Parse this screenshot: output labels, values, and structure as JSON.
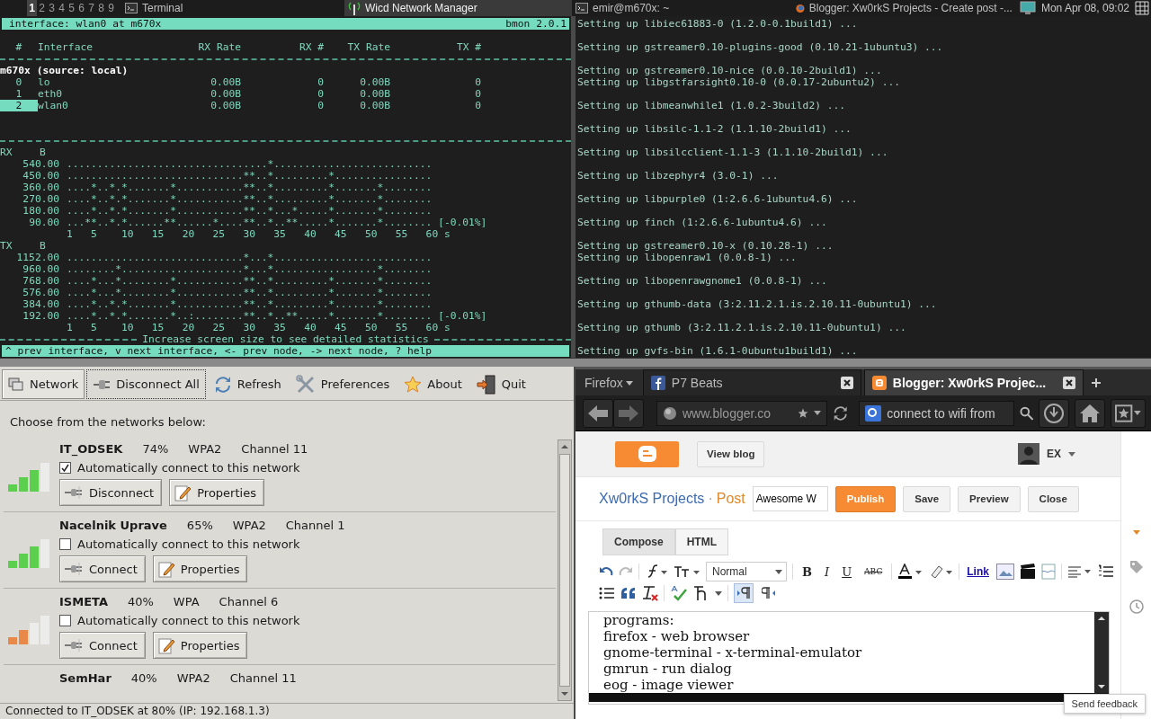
{
  "taskbar": {
    "workspaces": [
      {
        "label": "1",
        "selected": true
      },
      {
        "label": "2",
        "selected": false
      },
      {
        "label": "3",
        "selected": false
      },
      {
        "label": "4",
        "selected": false
      },
      {
        "label": "5",
        "selected": false
      },
      {
        "label": "6",
        "selected": false
      },
      {
        "label": "7",
        "selected": false
      },
      {
        "label": "8",
        "selected": false
      },
      {
        "label": "9",
        "selected": false
      }
    ],
    "tasks": [
      {
        "title": "Terminal",
        "kind": "terminal",
        "selected": false
      },
      {
        "title": "Wicd Network Manager",
        "kind": "antenna",
        "selected": true
      },
      {
        "title": "emir@m670x: ~",
        "kind": "terminal",
        "selected": false
      },
      {
        "title": "Blogger: Xw0rkS Projects - Create post -...",
        "kind": "firefox",
        "selected": false
      }
    ],
    "clock": "Mon Apr 08, 09:02"
  },
  "bmon": {
    "title": "interface: wlan0 at m670x",
    "version": "bmon 2.0.1",
    "columns": [
      "#",
      "Interface",
      "RX Rate",
      "RX #",
      "TX Rate",
      "TX #"
    ],
    "source": "m670x (source: local)",
    "interfaces": [
      {
        "index": "0",
        "name": "lo",
        "rx_rate": "0.00B",
        "rx_count": "0",
        "tx_rate": "0.00B",
        "tx_count": "0",
        "selected": false
      },
      {
        "index": "1",
        "name": "eth0",
        "rx_rate": "0.00B",
        "rx_count": "0",
        "tx_rate": "0.00B",
        "tx_count": "0",
        "selected": false
      },
      {
        "index": "2",
        "name": "wlan0",
        "rx_rate": "0.00B",
        "rx_count": "0",
        "tx_rate": "0.00B",
        "tx_count": "0",
        "selected": true
      }
    ],
    "graphs": [
      {
        "label": "RX",
        "unit": "B",
        "change": "[-0.01%]",
        "axis": "1   5    10   15   20   25   30   35   40   45   50   55   60 s",
        "rows": [
          {
            "value": "540.00",
            "plot": ".................................*.........................."
          },
          {
            "value": "450.00",
            "plot": ".............................**..*.........*................"
          },
          {
            "value": "360.00",
            "plot": "....*..*.*.......*...........**..*.........*.......*........"
          },
          {
            "value": "270.00",
            "plot": "....*..*.*.......*...........**..*.........*.......*........"
          },
          {
            "value": "180.00",
            "plot": "....*..*.*.......*...........**..*...*.....*.......*........"
          },
          {
            "value": "90.00",
            "plot": "...**..*.*......**......*....**..*..**.....*.......*........"
          }
        ]
      },
      {
        "label": "TX",
        "unit": "B",
        "change": "[-0.01%]",
        "axis": "1   5    10   15   20   25   30   35   40   45   50   55   60 s",
        "rows": [
          {
            "value": "1152.00",
            "plot": ".............................*...*.........................."
          },
          {
            "value": "960.00",
            "plot": "........*....................*...*.................*........"
          },
          {
            "value": "768.00",
            "plot": "....*...*........*...........**..*.........*.......*........"
          },
          {
            "value": "576.00",
            "plot": "....*...*........*...........**..*.........*.......*........"
          },
          {
            "value": "384.00",
            "plot": "....*..*.*.......*...........**..*.........*.......*........"
          },
          {
            "value": "192.00",
            "plot": "....*..*.*.......*..:........**..*..**.....*.......*........"
          }
        ]
      }
    ],
    "notice": "Increase screen size to see detailed statistics",
    "help": "^ prev interface, v next interface, <- prev node, -> next node, ? help"
  },
  "terminal": {
    "blocks": [
      [
        "Setting up libiec61883-0 (1.2.0-0.1build1) ..."
      ],
      [
        "Setting up gstreamer0.10-plugins-good (0.10.21-1ubuntu3) ..."
      ],
      [
        "Setting up gstreamer0.10-nice (0.0.10-2build1) ...",
        "Setting up libgstfarsight0.10-0 (0.0.17-2ubuntu2) ..."
      ],
      [
        "Setting up libmeanwhile1 (1.0.2-3build2) ..."
      ],
      [
        "Setting up libsilc-1.1-2 (1.1.10-2build1) ..."
      ],
      [
        "Setting up libsilcclient-1.1-3 (1.1.10-2build1) ..."
      ],
      [
        "Setting up libzephyr4 (3.0-1) ..."
      ],
      [
        "Setting up libpurple0 (1:2.6.6-1ubuntu4.6) ..."
      ],
      [
        "Setting up finch (1:2.6.6-1ubuntu4.6) ..."
      ],
      [
        "Setting up gstreamer0.10-x (0.10.28-1) ...",
        "Setting up libopenraw1 (0.0.8-1) ..."
      ],
      [
        "Setting up libopenrawgnome1 (0.0.8-1) ..."
      ],
      [
        "Setting up gthumb-data (3:2.11.2.1.is.2.10.11-0ubuntu1) ..."
      ],
      [
        "Setting up gthumb (3:2.11.2.1.is.2.10.11-0ubuntu1) ..."
      ],
      [
        "Setting up gvfs-bin (1.6.1-0ubuntu1build1) ..."
      ]
    ]
  },
  "wicd": {
    "tools": [
      {
        "label": "Network",
        "kind": "network",
        "framed": true,
        "focused": false
      },
      {
        "label": "Disconnect All",
        "kind": "disconnect",
        "framed": false,
        "focused": true
      },
      {
        "label": "Refresh",
        "kind": "refresh",
        "framed": false,
        "focused": false
      },
      {
        "label": "Preferences",
        "kind": "preferences",
        "framed": false,
        "focused": false
      },
      {
        "label": "About",
        "kind": "about",
        "framed": false,
        "focused": false
      },
      {
        "label": "Quit",
        "kind": "quit",
        "framed": false,
        "focused": false
      }
    ],
    "prompt": "Choose from the networks below:",
    "networks": [
      {
        "name": "IT_ODSEK",
        "strength": "74%",
        "security": "WPA2",
        "channel": "Channel 11",
        "level": 0.75,
        "color": "#5ccf4f",
        "auto_label": "Automatically connect to this network",
        "auto_connect": true,
        "action": "Disconnect",
        "properties": "Properties"
      },
      {
        "name": "Nacelnik Uprave",
        "strength": "65%",
        "security": "WPA2",
        "channel": "Channel 1",
        "level": 0.75,
        "color": "#5ccf4f",
        "auto_label": "Automatically connect to this network",
        "auto_connect": false,
        "action": "Connect",
        "properties": "Properties"
      },
      {
        "name": "ISMETA",
        "strength": "40%",
        "security": "WPA",
        "channel": "Channel 6",
        "level": 0.5,
        "color": "#e8894a",
        "auto_label": "Automatically connect to this network",
        "auto_connect": false,
        "action": "Connect",
        "properties": "Properties"
      }
    ],
    "partial_network": {
      "name": "SemHar",
      "strength": "40%",
      "security": "WPA2",
      "channel": "Channel 11"
    },
    "status": "Connected to IT_ODSEK at 80% (IP: 192.168.1.3)"
  },
  "browser": {
    "menu_button": "Firefox",
    "tabs": [
      {
        "title": "P7 Beats",
        "kind": "facebook",
        "selected": false
      },
      {
        "title": "Blogger: Xw0rkS Projec...",
        "kind": "blogger",
        "selected": true
      }
    ],
    "url": "www.blogger.co",
    "search": "connect to wifi from"
  },
  "blogger": {
    "view_blog": "View blog",
    "user": "EX",
    "blog_title": "Xw0rkS Projects",
    "separator": "·",
    "section": "Post",
    "post_title": "Awesome W",
    "actions": [
      {
        "label": "Publish",
        "kind": "primary"
      },
      {
        "label": "Save",
        "kind": "plain"
      },
      {
        "label": "Preview",
        "kind": "plain"
      },
      {
        "label": "Close",
        "kind": "plain"
      }
    ],
    "modes": [
      {
        "label": "Compose",
        "selected": true
      },
      {
        "label": "HTML",
        "selected": false
      }
    ],
    "font_size": "Normal",
    "format_buttons": [
      {
        "label": "B",
        "kind": "bold"
      },
      {
        "label": "I",
        "kind": "italic"
      },
      {
        "label": "U",
        "kind": "underline"
      },
      {
        "label": "ABC",
        "kind": "strike"
      }
    ],
    "link": "Link",
    "text_direction": [
      {
        "kind": "ltr",
        "selected": true
      },
      {
        "kind": "rtl",
        "selected": false
      }
    ],
    "body": [
      "programs:",
      "firefox - web browser",
      "gnome-terminal - x-terminal-emulator",
      "gmrun - run dialog",
      "eog - image viewer"
    ],
    "feedback": "Send feedback"
  }
}
